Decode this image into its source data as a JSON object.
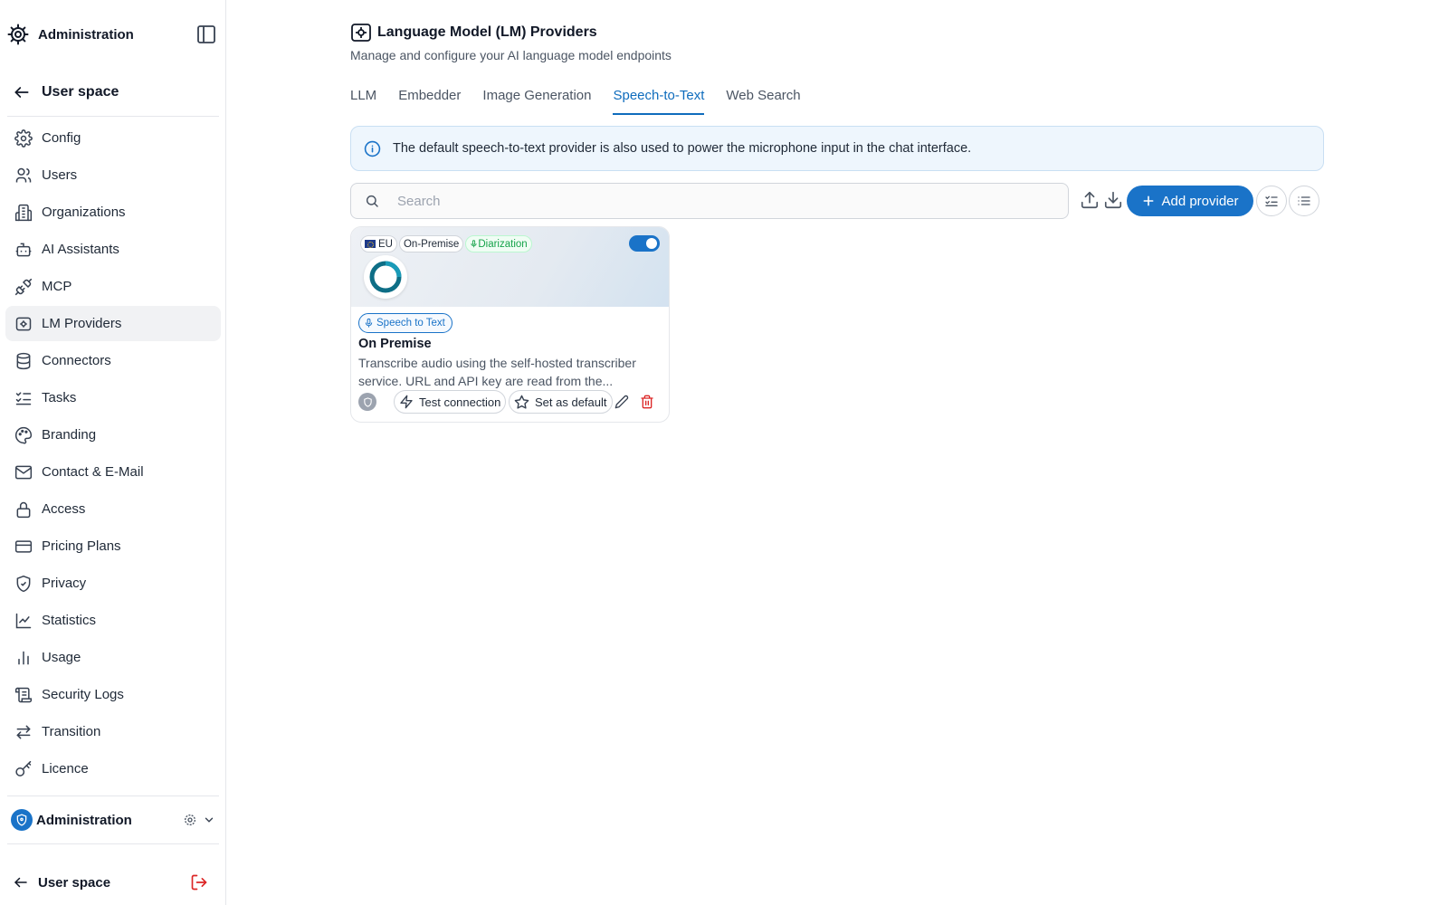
{
  "sidebar": {
    "title": "Administration",
    "back_label": "User space",
    "items": [
      {
        "label": "Config",
        "icon": "gear-icon"
      },
      {
        "label": "Users",
        "icon": "users-icon"
      },
      {
        "label": "Organizations",
        "icon": "building-icon"
      },
      {
        "label": "AI Assistants",
        "icon": "bot-icon"
      },
      {
        "label": "MCP",
        "icon": "plug-icon"
      },
      {
        "label": "LM Providers",
        "icon": "model-icon",
        "active": true
      },
      {
        "label": "Connectors",
        "icon": "database-icon"
      },
      {
        "label": "Tasks",
        "icon": "list-checks-icon"
      },
      {
        "label": "Branding",
        "icon": "palette-icon"
      },
      {
        "label": "Contact & E-Mail",
        "icon": "mail-icon"
      },
      {
        "label": "Access",
        "icon": "lock-icon"
      },
      {
        "label": "Pricing Plans",
        "icon": "credit-card-icon"
      },
      {
        "label": "Privacy",
        "icon": "shield-icon"
      },
      {
        "label": "Statistics",
        "icon": "chart-line-icon"
      },
      {
        "label": "Usage",
        "icon": "bar-chart-icon"
      },
      {
        "label": "Security Logs",
        "icon": "scroll-icon"
      },
      {
        "label": "Transition",
        "icon": "arrows-icon"
      },
      {
        "label": "Licence",
        "icon": "key-icon"
      }
    ],
    "org_label": "Administration",
    "bottom_label": "User space"
  },
  "page": {
    "title": "Language Model (LM) Providers",
    "subtitle": "Manage and configure your AI language model endpoints"
  },
  "tabs": [
    {
      "label": "LLM",
      "active": false
    },
    {
      "label": "Embedder",
      "active": false
    },
    {
      "label": "Image Generation",
      "active": false
    },
    {
      "label": "Speech-to-Text",
      "active": true
    },
    {
      "label": "Web Search",
      "active": false
    }
  ],
  "info_text": "The default speech-to-text provider is also used to power the microphone input in the chat interface.",
  "search": {
    "placeholder": "Search",
    "value": ""
  },
  "toolbar": {
    "add_label": "Add provider"
  },
  "card": {
    "chips": [
      "EU",
      "On-Premise",
      "Diarization"
    ],
    "enabled": true,
    "type_label": "Speech to Text",
    "title": "On Premise",
    "description": "Transcribe audio using the self-hosted transcriber service. URL and API key are read from the...",
    "test_label": "Test connection",
    "default_label": "Set as default"
  },
  "colors": {
    "accent": "#1a73c8",
    "active_tab": "#0f6cbd",
    "danger": "#dc2626",
    "success": "#16a34a",
    "info_bg": "#eef6fd"
  }
}
